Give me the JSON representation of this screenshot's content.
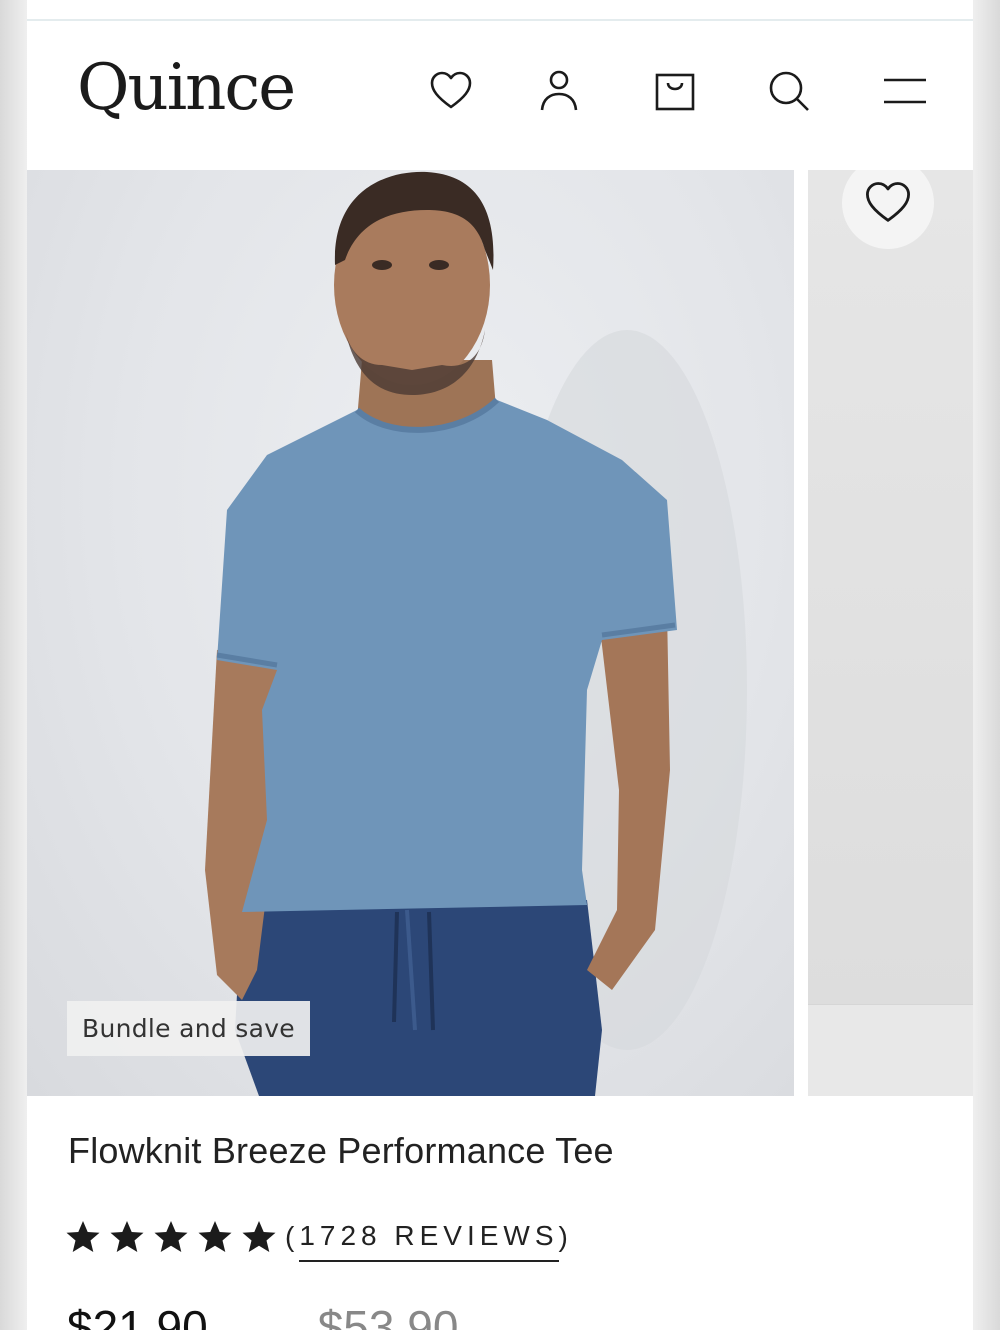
{
  "brand": {
    "logo_text": "Quince"
  },
  "header": {
    "icons": [
      "heart-icon",
      "account-icon",
      "shopping-bag-icon",
      "search-icon",
      "menu-icon"
    ]
  },
  "product": {
    "badge": "Bundle and save",
    "title": "Flowknit Breeze Performance Tee",
    "rating_stars": 5,
    "reviews_open": "(",
    "reviews_link": "1728 REVIEWS",
    "reviews_close": ")",
    "price": "$21.90",
    "compare_price": "$53.90"
  },
  "colors": {
    "shirt": "#6f95b9",
    "pants": "#2c4777",
    "backdrop": "#e3e5e9"
  }
}
